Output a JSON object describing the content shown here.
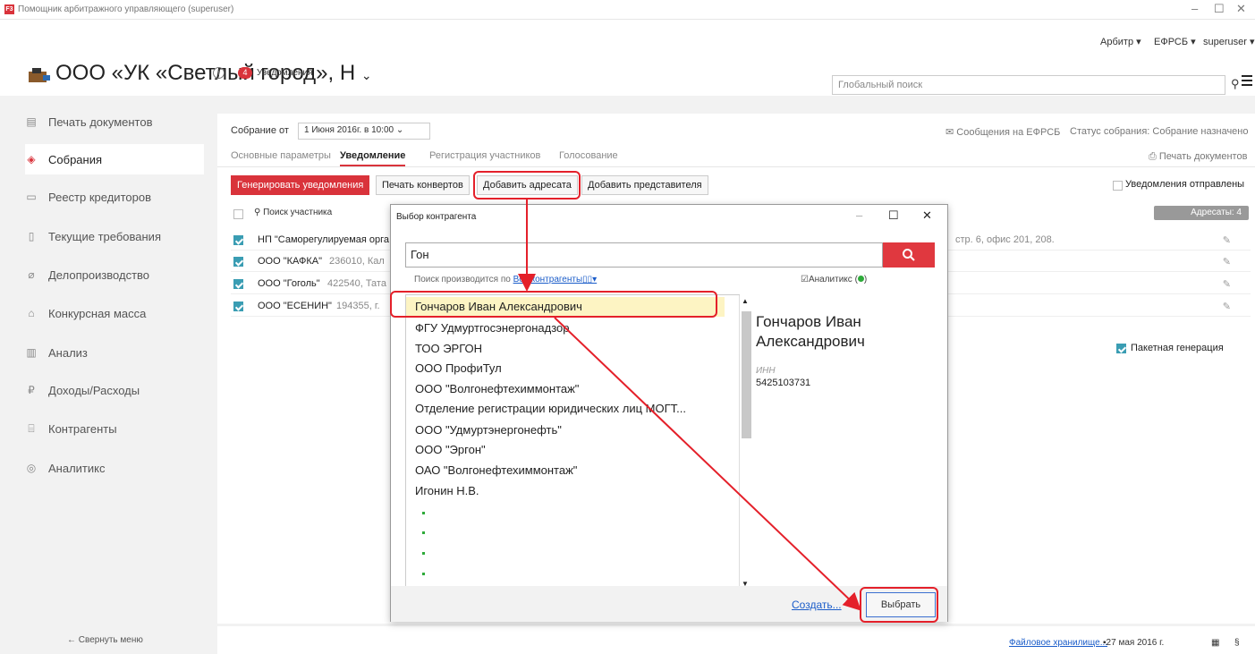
{
  "window": {
    "title": "Помощник арбитражного управляющего (superuser)",
    "logo": "F3"
  },
  "top_menu": {
    "arbitr": "Арбитр ▾",
    "efrsb": "ЕФРСБ ▾",
    "user": "superuser ▾"
  },
  "header": {
    "org_name": "ООО «УК «Светлый город», Н",
    "notifications_count": "4",
    "notifications_label": "Уведомления",
    "search_placeholder": "Глобальный поиск"
  },
  "sidebar": {
    "items": [
      {
        "label": "Печать документов",
        "icon": "document-icon"
      },
      {
        "label": "Собрания",
        "icon": "handshake-icon"
      },
      {
        "label": "Реестр кредиторов",
        "icon": "registry-icon"
      },
      {
        "label": "Текущие требования",
        "icon": "clipboard-icon"
      },
      {
        "label": "Делопроизводство",
        "icon": "paperclip-icon"
      },
      {
        "label": "Конкурсная масса",
        "icon": "box-icon"
      },
      {
        "label": "Анализ",
        "icon": "bar-chart-icon"
      },
      {
        "label": "Доходы/Расходы",
        "icon": "ruble-icon"
      },
      {
        "label": "Контрагенты",
        "icon": "bank-icon"
      },
      {
        "label": "Аналитикс",
        "icon": "analytics-icon"
      }
    ],
    "collapse": "←  Свернуть меню"
  },
  "meeting": {
    "label": "Собрание от",
    "date": "1 Июня 2016г. в 10:00",
    "efrsb_messages": "✉ Сообщения на ЕФРСБ",
    "status": "Статус собрания: Собрание назначено",
    "print_docs": "Печать документов"
  },
  "tabs": [
    "Основные параметры",
    "Уведомление",
    "Регистрация участников",
    "Голосование"
  ],
  "toolbar": {
    "generate": "Генерировать уведомления",
    "print_envelopes": "Печать конвертов",
    "add_addressee": "Добавить адресата",
    "add_representative": "Добавить представителя",
    "notifications_sent": "Уведомления отправлены",
    "addressees": "Адресаты: 4",
    "batch": "Пакетная генерация"
  },
  "participants": {
    "search": "Поиск участника",
    "rows": [
      {
        "name": "НП \"Саморегулируемая орга",
        "addr": "стр. 6, офис 201, 208."
      },
      {
        "name": "ООО \"КАФКА\"",
        "addr": "236010, Кал"
      },
      {
        "name": "ООО \"Гоголь\"",
        "addr": "422540, Тата"
      },
      {
        "name": "ООО \"ЕСЕНИН\"",
        "addr": "194355, г."
      }
    ]
  },
  "dialog": {
    "title": "Выбор контрагента",
    "query": "Гон",
    "hint": "Поиск производится по",
    "hint_link": "Все контрагенты▯▯▾",
    "analytix": "Аналитикс (",
    "results": [
      "Гончаров Иван Александрович",
      "ФГУ Удмуртгосэнергонадзор",
      "ТОО ЭРГОН",
      "ООО ПрофиТул",
      "ООО \"Волгонефтехиммонтаж\"",
      "Отделение регистрации юридических лиц МОГТ...",
      "ООО \"Удмуртэнергонефть\"",
      "ООО \"Эргон\"",
      "ОАО \"Волгонефтехиммонтаж\"",
      "Игонин Н.В."
    ],
    "detail_name": "Гончаров Иван Александрович",
    "inn_label": "ИНН",
    "inn": "5425103731",
    "create": "Создать...",
    "choose": "Выбрать"
  },
  "footer": {
    "storage": "Файловое хранилище...",
    "date": "27 мая 2016 г.",
    "sect": "§"
  }
}
